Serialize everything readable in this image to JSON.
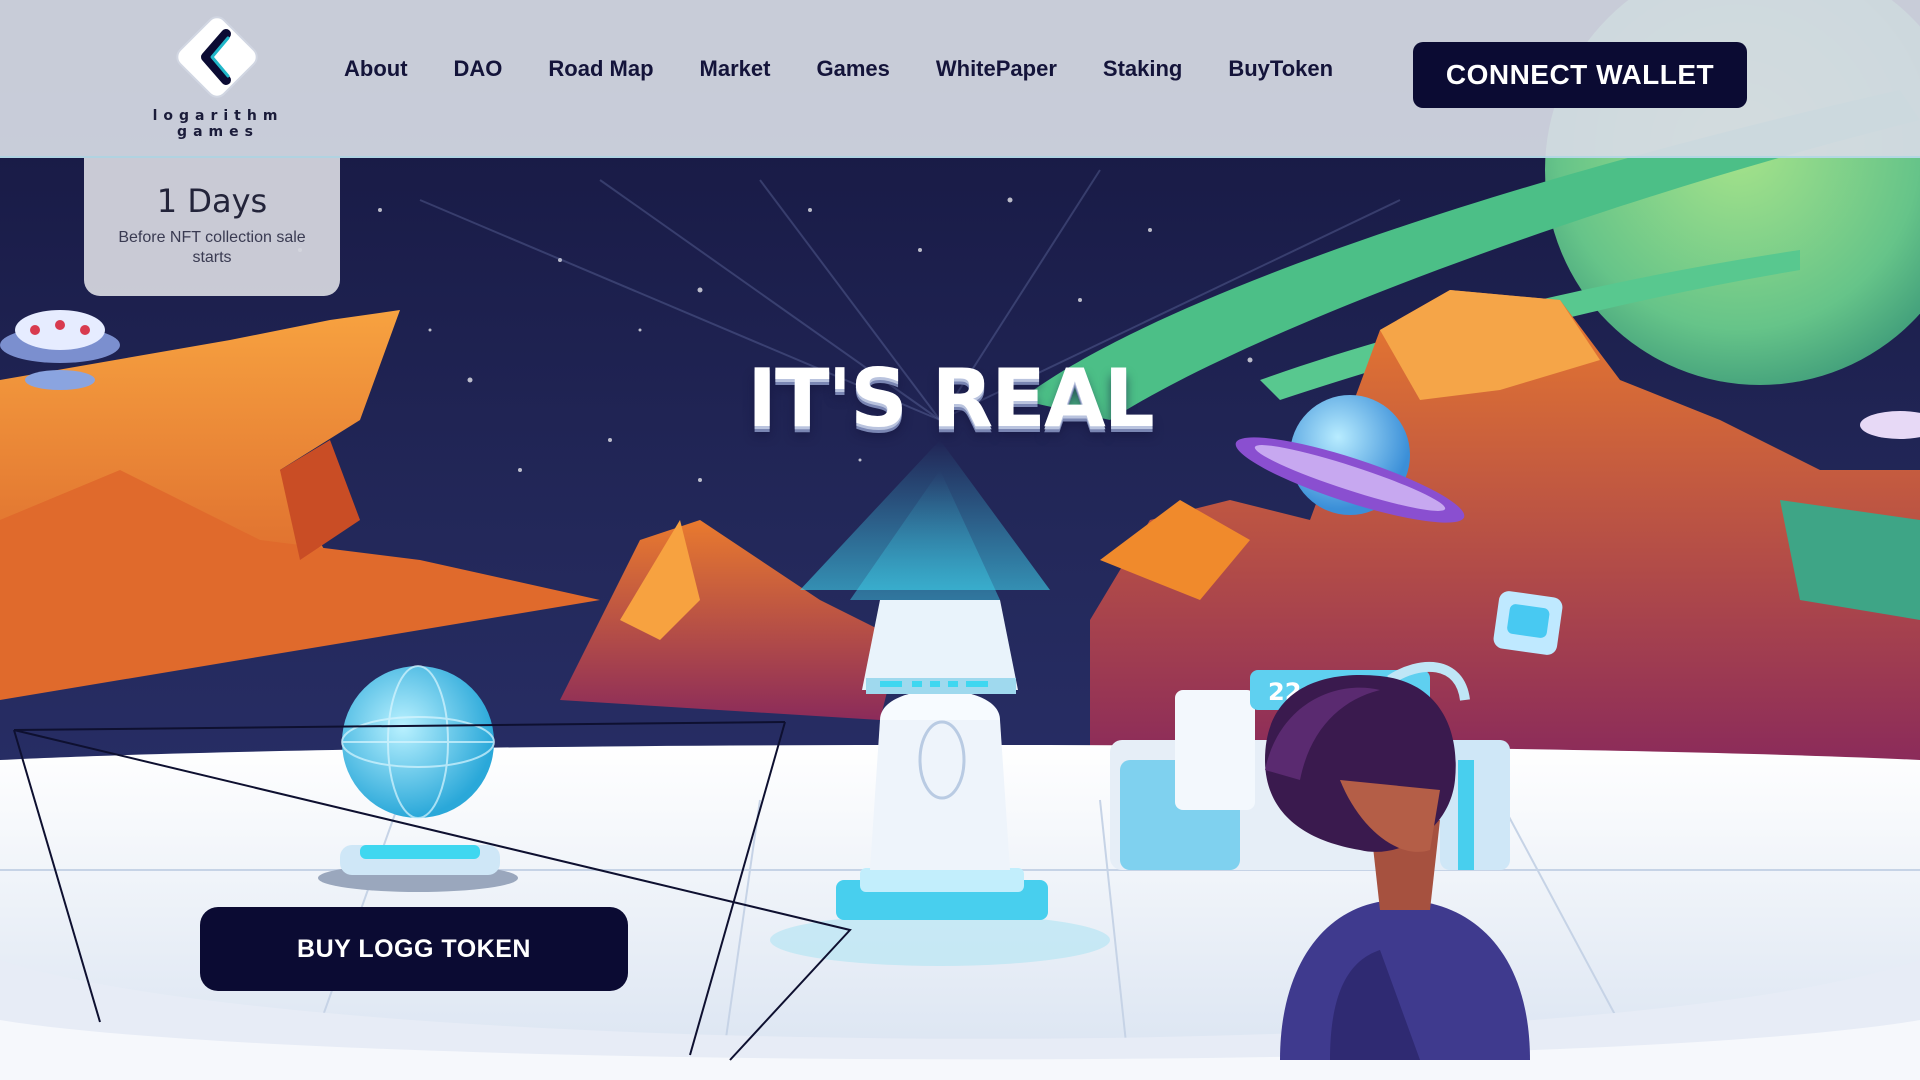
{
  "brand": {
    "logo_line1": "logarithm",
    "logo_line2": "games"
  },
  "nav": {
    "items": [
      {
        "label": "About"
      },
      {
        "label": "DAO"
      },
      {
        "label": "Road Map"
      },
      {
        "label": "Market"
      },
      {
        "label": "Games"
      },
      {
        "label": "WhitePaper"
      },
      {
        "label": "Staking"
      },
      {
        "label": "BuyToken"
      }
    ],
    "connect_label": "CONNECT WALLET"
  },
  "countdown": {
    "value": "1 Days",
    "description": "Before NFT collection sale starts"
  },
  "hero": {
    "headline": "IT'S REAL",
    "cta_label": "BUY LOGG TOKEN",
    "hologram_text": "22"
  },
  "colors": {
    "nav_text": "#14143a",
    "button_bg": "#0b0b33",
    "space_bg": "#1c1f4e",
    "rock_orange": "#f08a2c",
    "accent_cyan": "#3fd7f0"
  }
}
